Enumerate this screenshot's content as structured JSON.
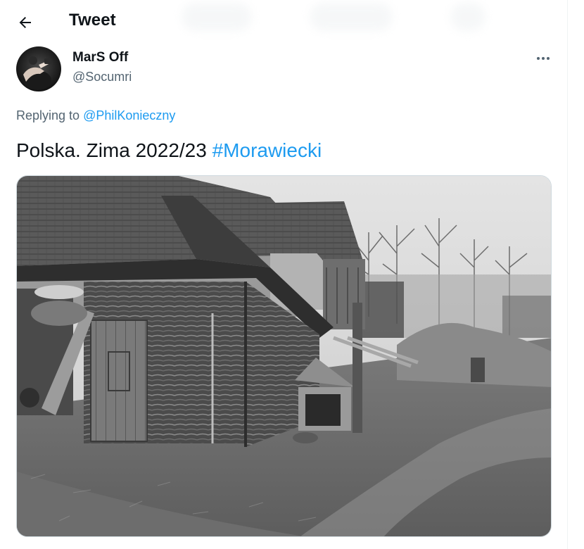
{
  "header": {
    "title": "Tweet",
    "back_icon": "arrow-left-icon"
  },
  "author": {
    "name": "MarS Off",
    "handle": "@Socumri"
  },
  "reply": {
    "prefix": "Replying to ",
    "mention": "@PhilKonieczny"
  },
  "tweet": {
    "text": "Polska. Zima 2022/23 ",
    "hashtag": "#Morawiecki"
  },
  "more_icon": "more-horizontal-icon",
  "colors": {
    "link": "#1d9bf0",
    "secondary_text": "#536471",
    "primary_text": "#0f1419",
    "border": "#cfd9de"
  }
}
